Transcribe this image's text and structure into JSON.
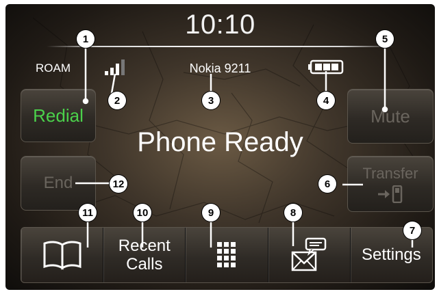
{
  "clock": {
    "time": "10:10"
  },
  "status": {
    "roam": "ROAM",
    "signal_icon": "signal-bars-icon",
    "phone_name": "Nokia 9211",
    "battery_icon": "battery-icon"
  },
  "main": {
    "status_text": "Phone Ready"
  },
  "side_buttons": {
    "redial": "Redial",
    "end": "End",
    "mute": "Mute",
    "transfer": "Transfer",
    "transfer_icon": "transfer-to-handset-icon"
  },
  "bottom_bar": {
    "phonebook_icon": "book-icon",
    "recent_calls_line1": "Recent",
    "recent_calls_line2": "Calls",
    "keypad_icon": "keypad-icon",
    "messaging_icon": "message-envelope-icon",
    "settings": "Settings"
  },
  "callouts": [
    "1",
    "2",
    "3",
    "4",
    "5",
    "6",
    "7",
    "8",
    "9",
    "10",
    "11",
    "12"
  ],
  "colors": {
    "redial_active": "#4bd14b",
    "disabled_text": "#6a655e"
  }
}
